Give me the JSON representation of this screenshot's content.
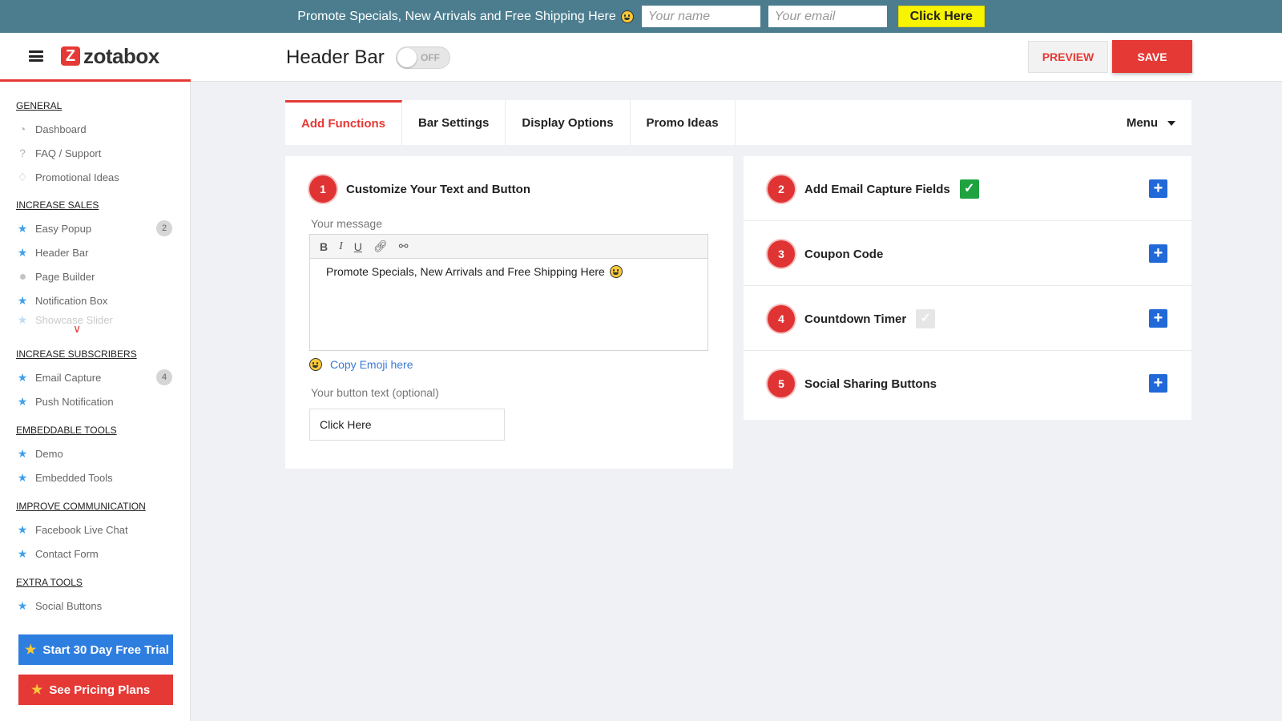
{
  "promo_bar": {
    "message": "Promote Specials, New Arrivals and Free Shipping Here",
    "name_placeholder": "Your name",
    "email_placeholder": "Your email",
    "button_label": "Click Here"
  },
  "header": {
    "logo_text": "zotabox",
    "page_title": "Header Bar",
    "toggle_label": "OFF",
    "preview_label": "PREVIEW",
    "save_label": "SAVE"
  },
  "sidebar": {
    "sections": [
      {
        "title": "GENERAL",
        "items": [
          {
            "label": "Dashboard",
            "icon": "dashboard-icon"
          },
          {
            "label": "FAQ / Support",
            "icon": "question-icon"
          },
          {
            "label": "Promotional Ideas",
            "icon": "lightbulb-icon"
          }
        ]
      },
      {
        "title": "INCREASE SALES",
        "items": [
          {
            "label": "Easy Popup",
            "icon": "star-icon",
            "badge": "2"
          },
          {
            "label": "Header Bar",
            "icon": "star-icon"
          },
          {
            "label": "Page Builder",
            "icon": "dot-icon"
          },
          {
            "label": "Notification Box",
            "icon": "star-icon"
          },
          {
            "label": "Showcase Slider",
            "icon": "star-icon"
          }
        ]
      },
      {
        "title": "INCREASE SUBSCRIBERS",
        "items": [
          {
            "label": "Email Capture",
            "icon": "star-icon",
            "badge": "4"
          },
          {
            "label": "Push Notification",
            "icon": "star-icon"
          }
        ]
      },
      {
        "title": "EMBEDDABLE TOOLS",
        "items": [
          {
            "label": "Demo",
            "icon": "star-icon"
          },
          {
            "label": "Embedded Tools",
            "icon": "star-icon"
          }
        ]
      },
      {
        "title": "IMPROVE COMMUNICATION",
        "items": [
          {
            "label": "Facebook Live Chat",
            "icon": "star-icon"
          },
          {
            "label": "Contact Form",
            "icon": "star-icon"
          }
        ]
      },
      {
        "title": "EXTRA TOOLS",
        "items": [
          {
            "label": "Social Buttons",
            "icon": "star-icon"
          }
        ]
      }
    ],
    "trial_button": "Start 30 Day Free Trial",
    "pricing_button": "See Pricing Plans"
  },
  "tabs": [
    {
      "label": "Add Functions",
      "active": true
    },
    {
      "label": "Bar Settings",
      "active": false
    },
    {
      "label": "Display Options",
      "active": false
    },
    {
      "label": "Promo Ideas",
      "active": false
    }
  ],
  "menu_label": "Menu",
  "customize": {
    "step": "1",
    "title": "Customize Your Text and Button",
    "message_label": "Your message",
    "message_value": "Promote Specials, New Arrivals and Free Shipping Here",
    "toolbar": [
      "B",
      "I",
      "U",
      "link-icon",
      "unlink-icon"
    ],
    "copy_emoji": "Copy Emoji here",
    "button_text_label": "Your button text (optional)",
    "button_text_value": "Click Here"
  },
  "functions": [
    {
      "step": "2",
      "title": "Add Email Capture Fields",
      "checked": true
    },
    {
      "step": "3",
      "title": "Coupon Code"
    },
    {
      "step": "4",
      "title": "Countdown Timer",
      "checked": false
    },
    {
      "step": "5",
      "title": "Social Sharing Buttons"
    }
  ],
  "colors": {
    "accent": "#e53935",
    "promo_bar_bg": "#4b7d8f",
    "promo_button_bg": "#f8f400",
    "plus_button": "#2168d8",
    "check_green": "#1fa340"
  }
}
